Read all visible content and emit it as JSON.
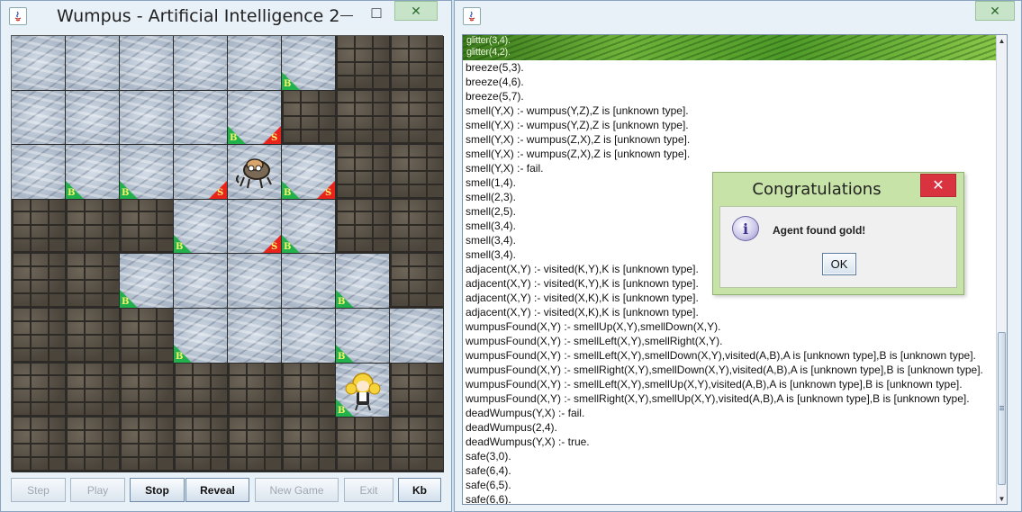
{
  "window1": {
    "title": "Wumpus - Artificial Intelligence 2",
    "minimize": "—",
    "maximize": "□",
    "close": "✕"
  },
  "board": {
    "rows": [
      [
        "light",
        "light",
        "light",
        "light",
        "light",
        "light",
        "dark",
        "dark"
      ],
      [
        "light",
        "light",
        "light",
        "light",
        "light",
        "dark",
        "dark",
        "dark"
      ],
      [
        "light",
        "light",
        "light",
        "light",
        "light",
        "light",
        "dark",
        "dark"
      ],
      [
        "dark",
        "dark",
        "dark",
        "light",
        "light",
        "light",
        "dark",
        "dark"
      ],
      [
        "dark",
        "dark",
        "light",
        "light",
        "light",
        "light",
        "light",
        "dark"
      ],
      [
        "dark",
        "dark",
        "dark",
        "light",
        "light",
        "light",
        "light",
        "light"
      ],
      [
        "dark",
        "dark",
        "dark",
        "dark",
        "dark",
        "dark",
        "light",
        "dark"
      ],
      [
        "dark",
        "dark",
        "dark",
        "dark",
        "dark",
        "dark",
        "dark",
        "dark"
      ]
    ],
    "markers": [
      {
        "r": 0,
        "c": 5,
        "b": true,
        "s": false
      },
      {
        "r": 1,
        "c": 4,
        "b": true,
        "s": true
      },
      {
        "r": 2,
        "c": 1,
        "b": true,
        "s": false
      },
      {
        "r": 2,
        "c": 2,
        "b": true,
        "s": false
      },
      {
        "r": 2,
        "c": 3,
        "b": false,
        "s": true
      },
      {
        "r": 2,
        "c": 5,
        "b": true,
        "s": true
      },
      {
        "r": 3,
        "c": 3,
        "b": true,
        "s": false
      },
      {
        "r": 3,
        "c": 4,
        "b": false,
        "s": true
      },
      {
        "r": 3,
        "c": 5,
        "b": true,
        "s": false
      },
      {
        "r": 4,
        "c": 2,
        "b": true,
        "s": false
      },
      {
        "r": 4,
        "c": 6,
        "b": true,
        "s": false
      },
      {
        "r": 5,
        "c": 3,
        "b": true,
        "s": false
      },
      {
        "r": 5,
        "c": 6,
        "b": true,
        "s": false
      },
      {
        "r": 6,
        "c": 6,
        "b": true,
        "s": false
      }
    ],
    "breeze_letter": "B",
    "stench_letter": "S",
    "wumpus": {
      "r": 2,
      "c": 4,
      "icon": "wumpus-icon"
    },
    "agent": {
      "r": 6,
      "c": 6,
      "icon": "agent-icon"
    },
    "colors": {
      "breeze": "#22b14c",
      "stench": "#e8231c",
      "letter": "#f7f26a"
    }
  },
  "buttons": {
    "step": "Step",
    "play": "Play",
    "stop": "Stop",
    "reveal": "Reveal",
    "new_game": "New Game",
    "exit": "Exit",
    "kb": "Kb"
  },
  "window2": {
    "close": "✕"
  },
  "kb": {
    "banner_lines": [
      "glitter(3,4).",
      "glitter(4,2)."
    ],
    "lines": [
      "breeze(5,3).",
      "breeze(4,6).",
      "breeze(5,7).",
      "smell(Y,X) :- wumpus(Y,Z),Z is [unknown type].",
      "smell(Y,X) :- wumpus(Y,Z),Z is [unknown type].",
      "smell(Y,X) :- wumpus(Z,X),Z is [unknown type].",
      "smell(Y,X) :- wumpus(Z,X),Z is [unknown type].",
      "smell(Y,X) :- fail.",
      "smell(1,4).",
      "smell(2,3).",
      "smell(2,5).",
      "smell(3,4).",
      "smell(3,4).",
      "smell(3,4).",
      "adjacent(X,Y) :- visited(K,Y),K is [unknown type].",
      "adjacent(X,Y) :- visited(K,Y),K is [unknown type].",
      "adjacent(X,Y) :- visited(X,K),K is [unknown type].",
      "adjacent(X,Y) :- visited(X,K),K is [unknown type].",
      "wumpusFound(X,Y) :- smellUp(X,Y),smellDown(X,Y).",
      "wumpusFound(X,Y) :- smellLeft(X,Y),smellRight(X,Y).",
      "wumpusFound(X,Y) :- smellLeft(X,Y),smellDown(X,Y),visited(A,B),A is [unknown type],B is [unknown type].",
      "wumpusFound(X,Y) :- smellRight(X,Y),smellDown(X,Y),visited(A,B),A is [unknown type],B is [unknown type].",
      "wumpusFound(X,Y) :- smellLeft(X,Y),smellUp(X,Y),visited(A,B),A is [unknown type],B is [unknown type].",
      "wumpusFound(X,Y) :- smellRight(X,Y),smellUp(X,Y),visited(A,B),A is [unknown type],B is [unknown type].",
      "deadWumpus(Y,X) :- fail.",
      "deadWumpus(2,4).",
      "deadWumpus(Y,X) :- true.",
      "safe(3,0).",
      "safe(6,4).",
      "safe(6,5).",
      "safe(6,6)."
    ]
  },
  "dialog": {
    "title": "Congratulations",
    "close": "✕",
    "message": "Agent found gold!",
    "ok": "OK",
    "icon": "info-icon"
  }
}
